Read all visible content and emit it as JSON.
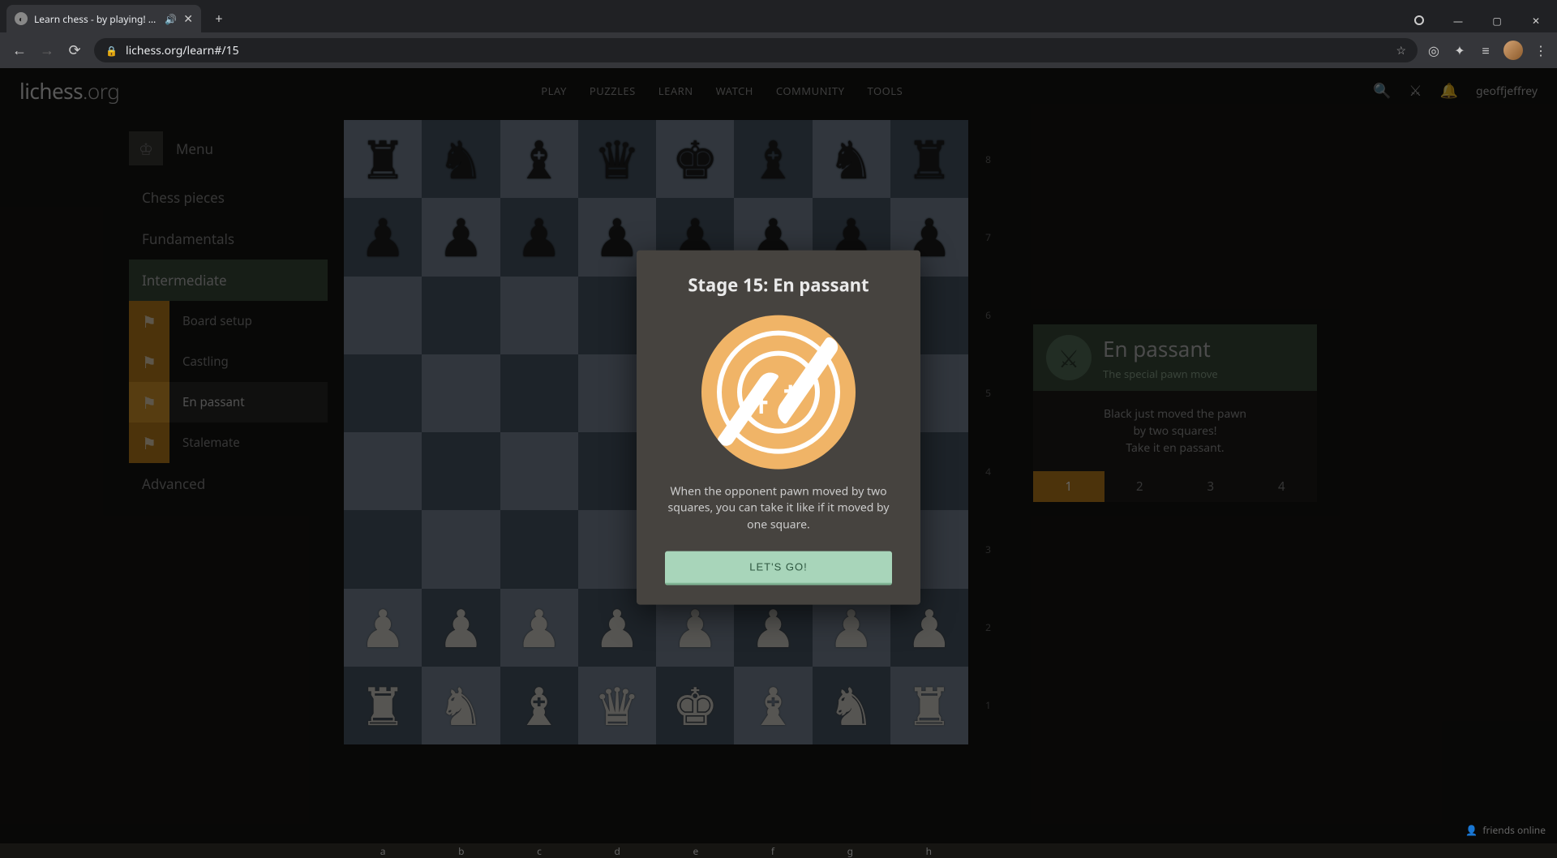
{
  "browser": {
    "tab_title": "Learn chess - by playing! • lic",
    "url": "lichess.org/learn#/15",
    "window_controls": {
      "minimize": "—",
      "maximize": "▢",
      "close": "✕"
    }
  },
  "header": {
    "logo_prefix": "lichess",
    "logo_suffix": ".org",
    "nav": [
      "PLAY",
      "PUZZLES",
      "LEARN",
      "WATCH",
      "COMMUNITY",
      "TOOLS"
    ],
    "username": "geoffjeffrey"
  },
  "sidebar": {
    "menu_label": "Menu",
    "categories": [
      {
        "label": "Chess pieces",
        "active": false
      },
      {
        "label": "Fundamentals",
        "active": false
      },
      {
        "label": "Intermediate",
        "active": true
      },
      {
        "label": "Advanced",
        "active": false
      }
    ],
    "lessons": [
      {
        "label": "Board setup",
        "icon": "board-setup-icon"
      },
      {
        "label": "Castling",
        "icon": "castling-icon"
      },
      {
        "label": "En passant",
        "icon": "en-passant-icon",
        "active": true
      },
      {
        "label": "Stalemate",
        "icon": "stalemate-icon"
      }
    ]
  },
  "board": {
    "ranks": [
      "8",
      "7",
      "6",
      "5",
      "4",
      "3",
      "2",
      "1"
    ],
    "files": [
      "a",
      "b",
      "c",
      "d",
      "e",
      "f",
      "g",
      "h"
    ],
    "position": [
      [
        "r",
        "n",
        "b",
        "q",
        "k",
        "b",
        "n",
        "r"
      ],
      [
        "p",
        "p",
        "p",
        "p",
        "p",
        "p",
        "p",
        "p"
      ],
      [
        "",
        "",
        "",
        "",
        "",
        "",
        "",
        ""
      ],
      [
        "",
        "",
        "",
        "",
        "",
        "",
        "",
        ""
      ],
      [
        "",
        "",
        "",
        "",
        "",
        "",
        "",
        ""
      ],
      [
        "",
        "",
        "",
        "",
        "",
        "",
        "",
        ""
      ],
      [
        "P",
        "P",
        "P",
        "P",
        "P",
        "P",
        "P",
        "P"
      ],
      [
        "R",
        "N",
        "B",
        "Q",
        "K",
        "B",
        "N",
        "R"
      ]
    ]
  },
  "right_panel": {
    "title": "En passant",
    "subtitle": "The special pawn move",
    "instruction_lines": [
      "Black just moved the pawn",
      "by two squares!",
      "Take it en passant."
    ],
    "levels": [
      "1",
      "2",
      "3",
      "4"
    ],
    "active_level": "1"
  },
  "modal": {
    "title": "Stage 15: En passant",
    "description": "When the opponent pawn moved by two squares, you can take it like if it moved by one square.",
    "button_label": "LET'S GO!"
  },
  "footer": {
    "friends_label": "friends online"
  },
  "piece_glyphs": {
    "r": "♜",
    "n": "♞",
    "b": "♝",
    "q": "♛",
    "k": "♚",
    "p": "♟",
    "R": "♜",
    "N": "♞",
    "B": "♝",
    "Q": "♛",
    "K": "♚",
    "P": "♟"
  }
}
